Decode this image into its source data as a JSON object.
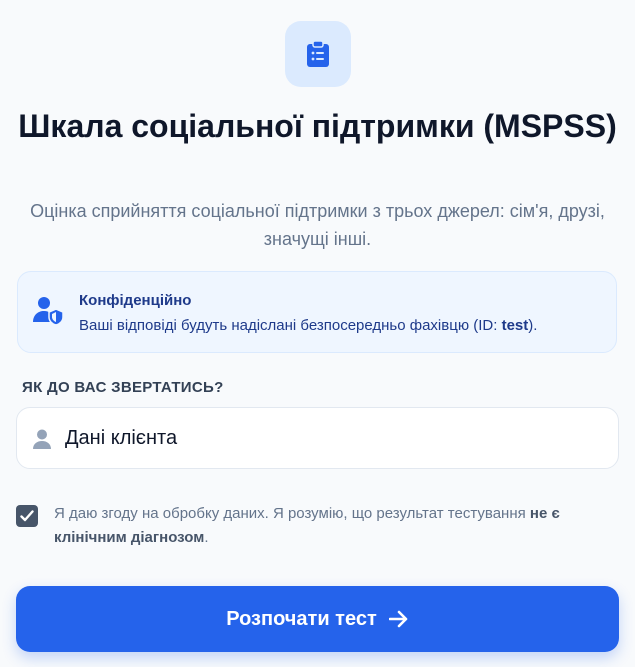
{
  "header": {
    "icon": "clipboard-list-icon",
    "title": "Шкала соціальної підтримки (MSPSS)",
    "subtitle": "Оцінка сприйняття соціальної підтримки з трьох джерел: сім'я, друзі, значущі інші."
  },
  "privacy_notice": {
    "icon": "user-shield-icon",
    "title": "Конфіденційно",
    "text_before": "Ваші відповіді будуть надіслані безпосередньо фахівцю (ID: ",
    "client_id": "test",
    "text_after": ")."
  },
  "name_field": {
    "label": "ЯК ДО ВАС ЗВЕРТАТИСЬ?",
    "icon": "user-icon",
    "value": "Дані клієнта"
  },
  "consent": {
    "checked": true,
    "text": "Я даю згоду на обробку даних. Я розумію, що результат тестування ",
    "emphasis": "не є клінічним діагнозом",
    "text_end": "."
  },
  "start_button": {
    "label": "Розпочати тест",
    "icon": "arrow-right-icon"
  },
  "colors": {
    "accent": "#2563eb",
    "notice_bg": "#eff6ff",
    "notice_text": "#1e3a8a",
    "muted_text": "#64748b"
  }
}
